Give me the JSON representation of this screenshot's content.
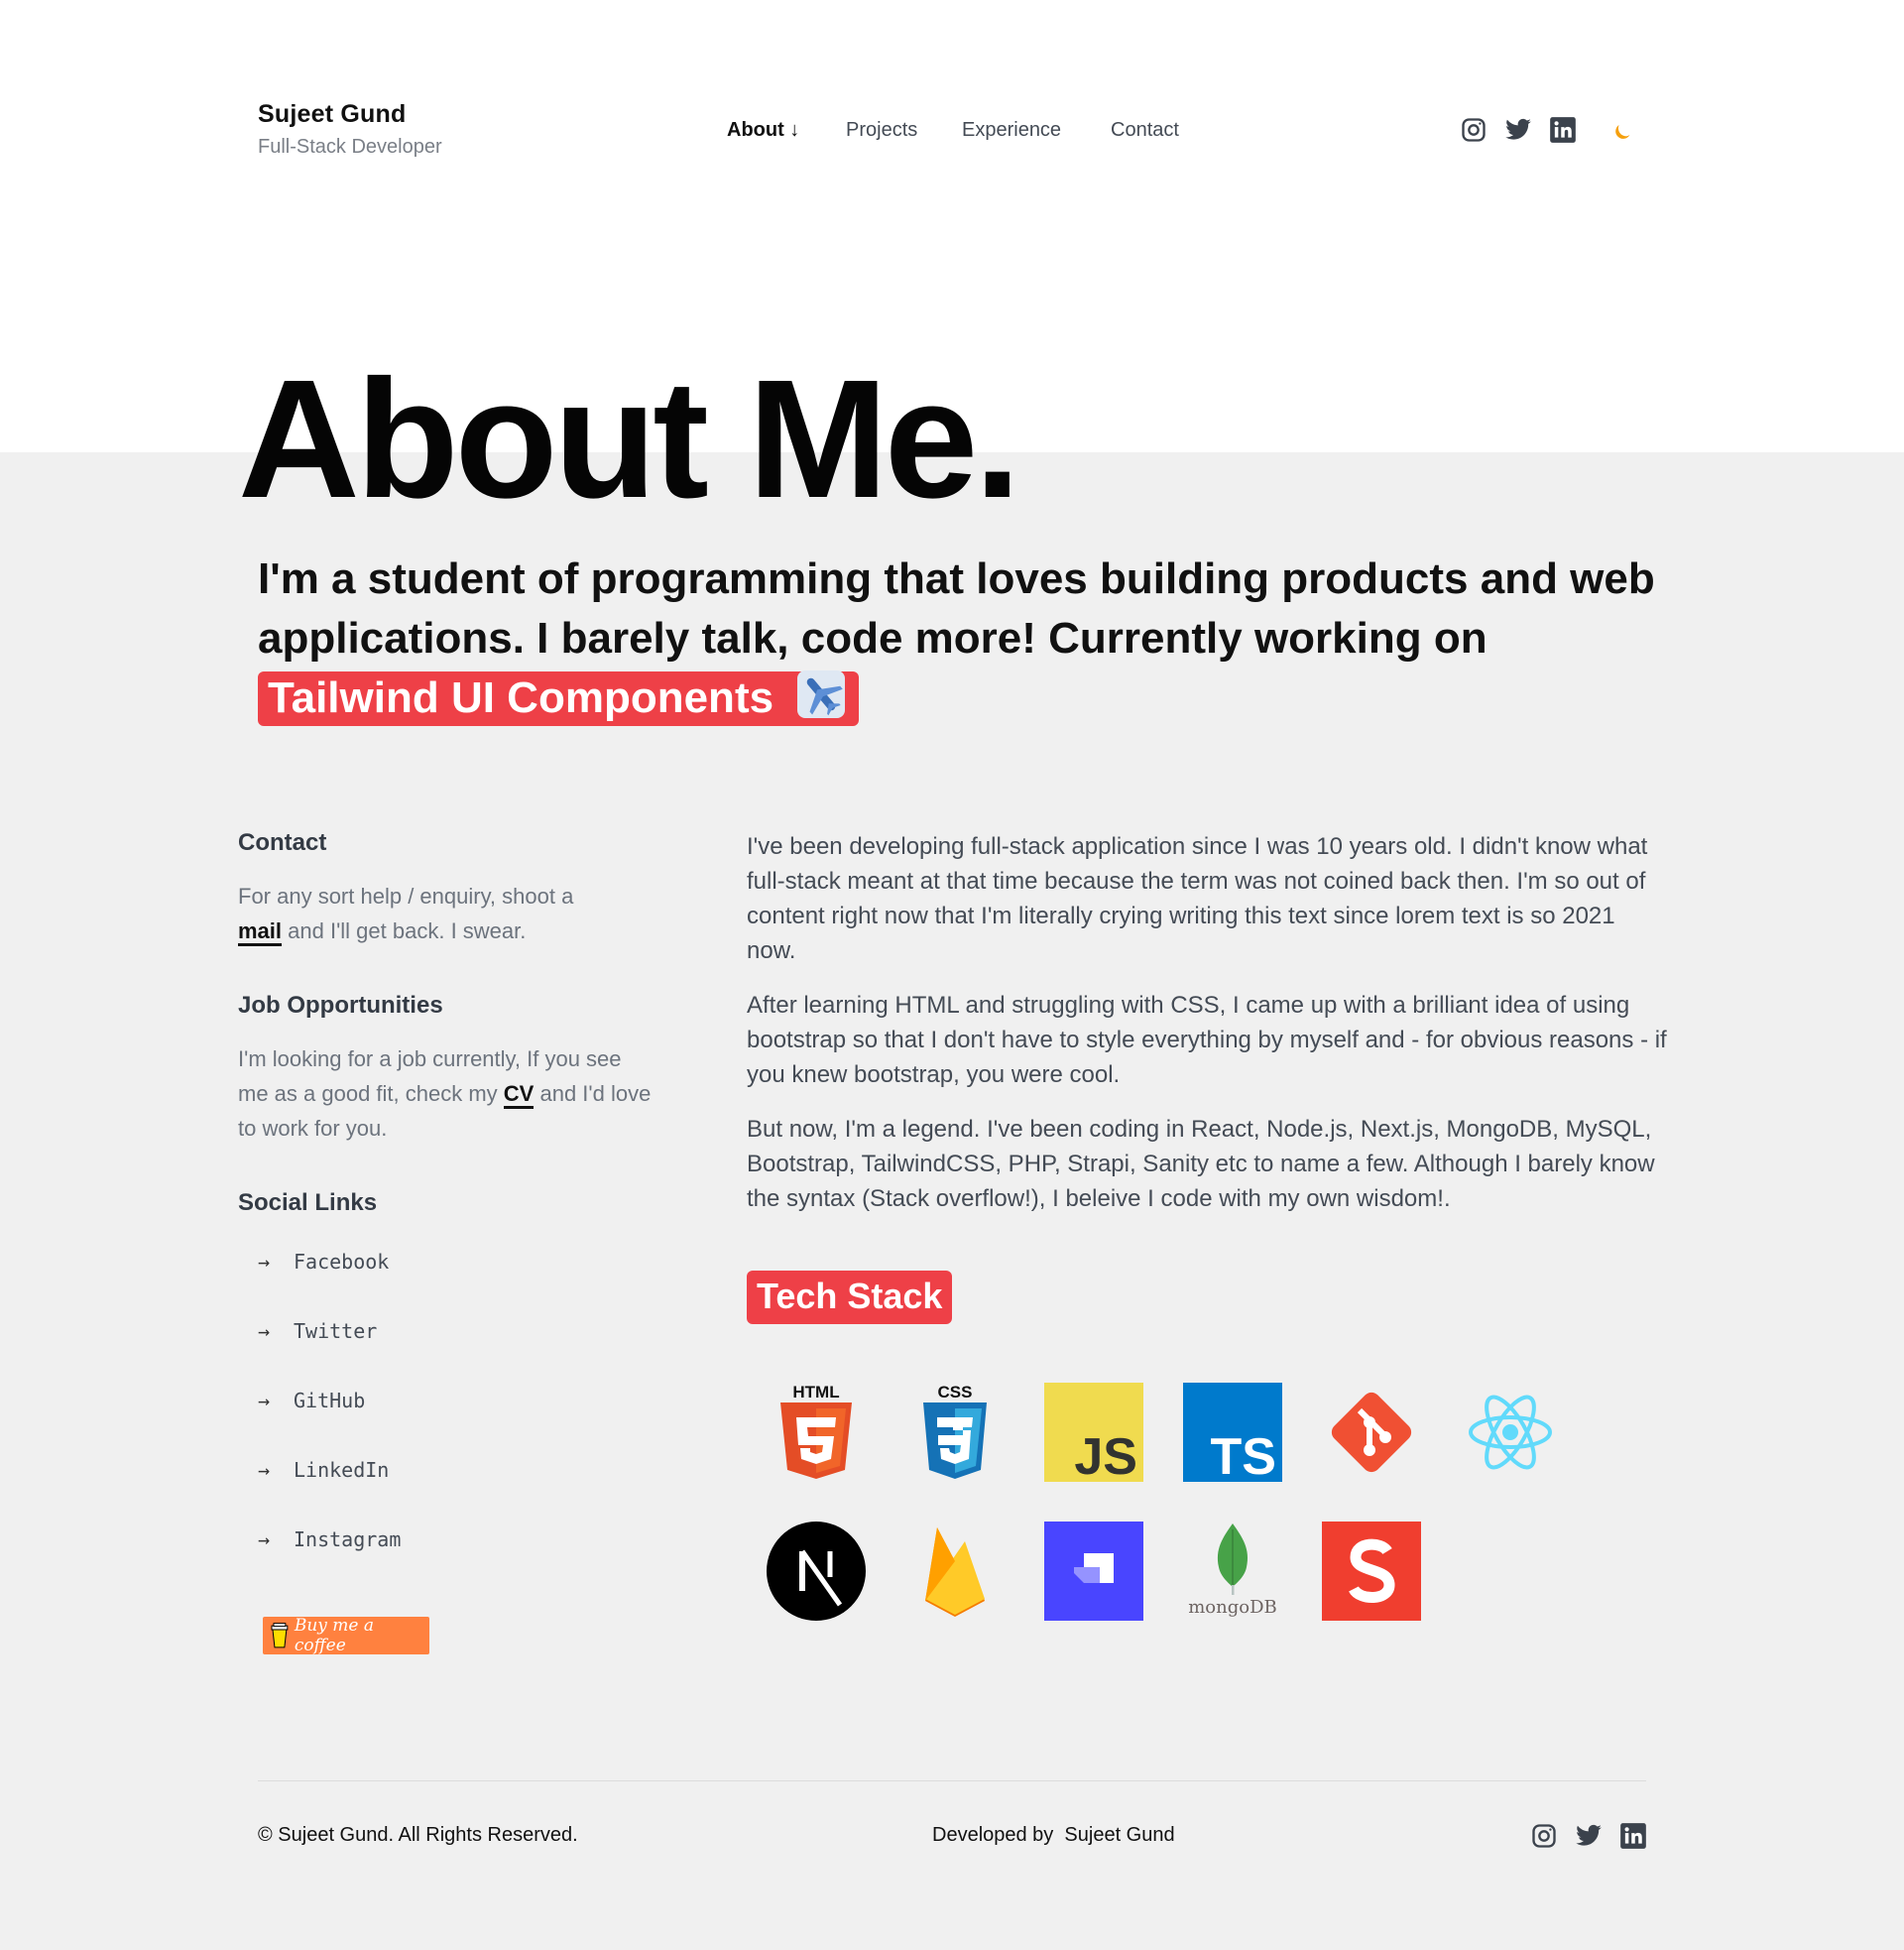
{
  "header": {
    "brand_name": "Sujeet Gund",
    "brand_role": "Full-Stack Developer",
    "nav": {
      "about": "About ↓",
      "projects": "Projects",
      "experience": "Experience",
      "contact": "Contact"
    },
    "icons": [
      "instagram-icon",
      "twitter-icon",
      "linkedin-icon",
      "moon-icon"
    ]
  },
  "hero": {
    "title": "About Me.",
    "subtitle": "I'm a student of programming that loves building products and web applications. I barely talk, code more! Currently working on",
    "highlight": "Tailwind UI Components",
    "highlight_emoji": "airplane-icon"
  },
  "contact": {
    "heading": "Contact",
    "text_before": "For any sort help / enquiry, shoot a",
    "link": "mail",
    "text_after": "and I'll get back. I swear."
  },
  "jobs": {
    "heading": "Job Opportunities",
    "text_before": "I'm looking for a job currently, If you see me as a good fit, check my",
    "link": "CV",
    "text_after": "and I'd love to work for you."
  },
  "social": {
    "heading": "Social Links",
    "arrow": "→",
    "links": [
      "Facebook",
      "Twitter",
      "GitHub",
      "LinkedIn",
      "Instagram"
    ]
  },
  "coffee_button": "Buy me a coffee",
  "bio": {
    "p1": "I've been developing full-stack application since I was 10 years old. I didn't know what full-stack meant at that time because the term was not coined back then. I'm so out of content right now that I'm literally crying writing this text since lorem text is so 2021 now.",
    "p2": "After learning HTML and struggling with CSS, I came up with a brilliant idea of using bootstrap so that I don't have to style everything by myself and - for obvious reasons - if you knew bootstrap, you were cool.",
    "p3": "But now, I'm a legend. I've been coding in React, Node.js, Next.js, MongoDB, MySQL, Bootstrap, TailwindCSS, PHP, Strapi, Sanity etc to name a few. Although I barely know the syntax (Stack overflow!), I beleive I code with my own wisdom!."
  },
  "tech_stack": {
    "title": "Tech Stack",
    "logos": {
      "html": "HTML",
      "css": "CSS",
      "js": "JS",
      "ts": "TS",
      "mongodb": "mongoDB"
    },
    "items": [
      "html5-icon",
      "css3-icon",
      "javascript-icon",
      "typescript-icon",
      "git-icon",
      "react-icon",
      "nextjs-icon",
      "firebase-icon",
      "strapi-icon",
      "mongodb-icon",
      "sanity-icon"
    ]
  },
  "footer": {
    "copyright": "© Sujeet Gund. All Rights Reserved.",
    "developed": "Developed by  Sujeet Gund",
    "icons": [
      "instagram-icon",
      "twitter-icon",
      "linkedin-icon"
    ]
  },
  "colors": {
    "accent_red": "#ee4047",
    "moon": "#f5a00d",
    "page_grey": "#f0f0f0",
    "coffee_orange": "#ff813f"
  }
}
